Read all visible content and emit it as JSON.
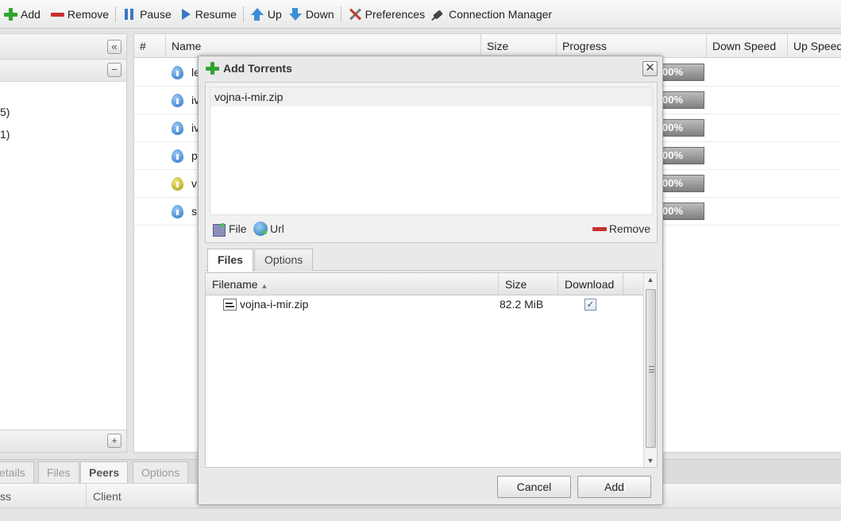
{
  "toolbar": {
    "add": "Add",
    "remove": "Remove",
    "pause": "Pause",
    "resume": "Resume",
    "up": "Up",
    "down": "Down",
    "preferences": "Preferences",
    "connection_manager": "Connection Manager"
  },
  "sidebar": {
    "items": [
      "5)",
      "1)"
    ]
  },
  "grid": {
    "columns": [
      "#",
      "Name",
      "Size",
      "Progress",
      "Down Speed",
      "Up Speed"
    ],
    "rows": [
      {
        "name": "le",
        "state": "seeding",
        "progress": "00%"
      },
      {
        "name": "iv",
        "state": "seeding",
        "progress": "00%"
      },
      {
        "name": "iv",
        "state": "seeding",
        "progress": "00%"
      },
      {
        "name": "p",
        "state": "seeding",
        "progress": "00%"
      },
      {
        "name": "v",
        "state": "queued",
        "progress": "00%"
      },
      {
        "name": "s",
        "state": "seeding",
        "progress": "00%"
      }
    ]
  },
  "bottom": {
    "tabs": [
      "etails",
      "Files",
      "Peers",
      "Options"
    ],
    "active_tab": "Peers",
    "columns": [
      "ss",
      "Client"
    ]
  },
  "dialog": {
    "title": "Add Torrents",
    "torrent_list": [
      "vojna-i-mir.zip"
    ],
    "file_button": "File",
    "url_button": "Url",
    "remove_button": "Remove",
    "tabs": [
      "Files",
      "Options"
    ],
    "active_tab": "Files",
    "files_columns": {
      "filename": "Filename",
      "size": "Size",
      "download": "Download"
    },
    "files": [
      {
        "name": "vojna-i-mir.zip",
        "size": "82.2 MiB",
        "download": true
      }
    ],
    "cancel": "Cancel",
    "add": "Add"
  },
  "colors": {
    "accent_green": "#2fa52f",
    "remove_red": "#c9302c",
    "blue": "#3a78c3"
  }
}
